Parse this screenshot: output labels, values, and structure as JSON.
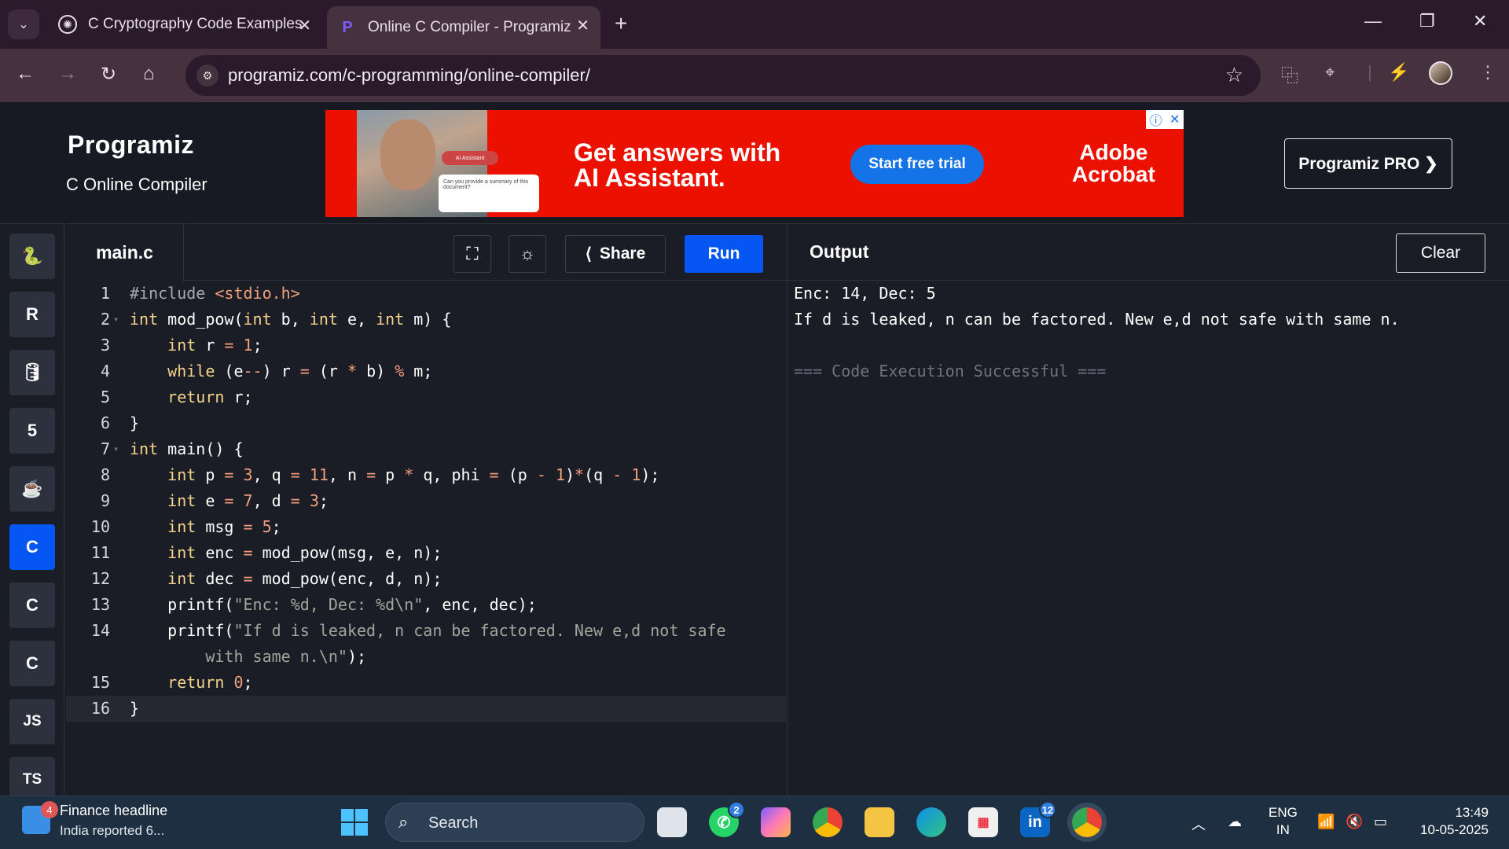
{
  "browser": {
    "tabs": [
      {
        "title": "C Cryptography Code Examples",
        "active": false
      },
      {
        "title": "Online C Compiler - Programiz",
        "active": true
      }
    ],
    "url": "programiz.com/c-programming/online-compiler/"
  },
  "header": {
    "logo": "Programiz",
    "subtitle": "C Online Compiler",
    "pro_button": "Programiz PRO ❯"
  },
  "ad": {
    "headline_line1": "Get answers with",
    "headline_line2": "AI Assistant.",
    "cta": "Start free trial",
    "brand_line1": "Adobe",
    "brand_line2": "Acrobat",
    "pill": "AI Assistant",
    "card_text": "Can you provide a summary of this document?"
  },
  "sidebar": {
    "languages": [
      {
        "name": "python",
        "glyph": "🐍"
      },
      {
        "name": "r",
        "glyph": "R"
      },
      {
        "name": "sql",
        "glyph": "🛢"
      },
      {
        "name": "html",
        "glyph": "5"
      },
      {
        "name": "java",
        "glyph": "☕"
      },
      {
        "name": "c",
        "glyph": "C",
        "active": true
      },
      {
        "name": "cpp",
        "glyph": "C"
      },
      {
        "name": "csharp",
        "glyph": "C"
      },
      {
        "name": "js",
        "glyph": "JS"
      },
      {
        "name": "ts",
        "glyph": "TS"
      }
    ]
  },
  "editor": {
    "filename": "main.c",
    "share_label": "Share",
    "run_label": "Run",
    "lines": [
      {
        "n": "1",
        "code": "#include <stdio.h>"
      },
      {
        "n": "2",
        "code": "int mod_pow(int b, int e, int m) {"
      },
      {
        "n": "3",
        "code": "    int r = 1;"
      },
      {
        "n": "4",
        "code": "    while (e--) r = (r * b) % m;"
      },
      {
        "n": "5",
        "code": "    return r;"
      },
      {
        "n": "6",
        "code": "}"
      },
      {
        "n": "7",
        "code": "int main() {"
      },
      {
        "n": "8",
        "code": "    int p = 3, q = 11, n = p * q, phi = (p - 1)*(q - 1);"
      },
      {
        "n": "9",
        "code": "    int e = 7, d = 3;"
      },
      {
        "n": "10",
        "code": "    int msg = 5;"
      },
      {
        "n": "11",
        "code": "    int enc = mod_pow(msg, e, n);"
      },
      {
        "n": "12",
        "code": "    int dec = mod_pow(enc, d, n);"
      },
      {
        "n": "13",
        "code": "    printf(\"Enc: %d, Dec: %d\\n\", enc, dec);"
      },
      {
        "n": "14",
        "code": "    printf(\"If d is leaked, n can be factored. New e,d not safe"
      },
      {
        "n": "",
        "code": "        with same n.\\n\");"
      },
      {
        "n": "15",
        "code": "    return 0;"
      },
      {
        "n": "16",
        "code": "}"
      }
    ]
  },
  "output": {
    "title": "Output",
    "clear_label": "Clear",
    "lines": [
      "Enc: 14, Dec: 5",
      "If d is leaked, n can be factored. New e,d not safe with same n.",
      "",
      "=== Code Execution Successful ==="
    ]
  },
  "taskbar": {
    "news_badge": "4",
    "news_title": "Finance headline",
    "news_sub": "India reported 6...",
    "search_label": "Search",
    "whatsapp_badge": "2",
    "linkedin_badge": "12",
    "lang_top": "ENG",
    "lang_bottom": "IN",
    "time": "13:49",
    "date": "10-05-2025"
  }
}
